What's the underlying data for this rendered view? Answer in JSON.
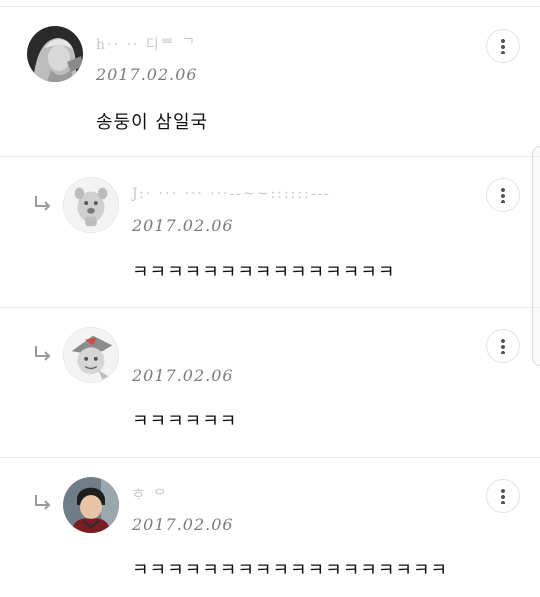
{
  "comments": [
    {
      "name": "h·· ·· 디ᄈ ᄀ",
      "date": "2017.02.06",
      "text": "송둥이 삼일국",
      "is_reply": false,
      "avatar_icon": "profile-photo-blonde"
    },
    {
      "name": "J:·  ··· ··· ···--~~::::::---",
      "date": "2017.02.06",
      "text": "ㅋㅋㅋㅋㅋㅋㅋㅋㅋㅋㅋㅋㅋㅋㅋ",
      "is_reply": true,
      "avatar_icon": "cartoon-dog-avatar"
    },
    {
      "name": "",
      "date": "2017.02.06",
      "text": "ㅋㅋㅋㅋㅋㅋ",
      "is_reply": true,
      "avatar_icon": "cartoon-character-avatar"
    },
    {
      "name": "ᄒᆞ ᄋ",
      "date": "2017.02.06",
      "text": "ㅋㅋㅋㅋㅋㅋㅋㅋㅋㅋㅋㅋㅋㅋㅋㅋㅋㅋ",
      "is_reply": true,
      "avatar_icon": "profile-photo-boy"
    }
  ],
  "icons": {
    "more": "more-vertical-icon",
    "reply": "reply-arrow-icon"
  }
}
